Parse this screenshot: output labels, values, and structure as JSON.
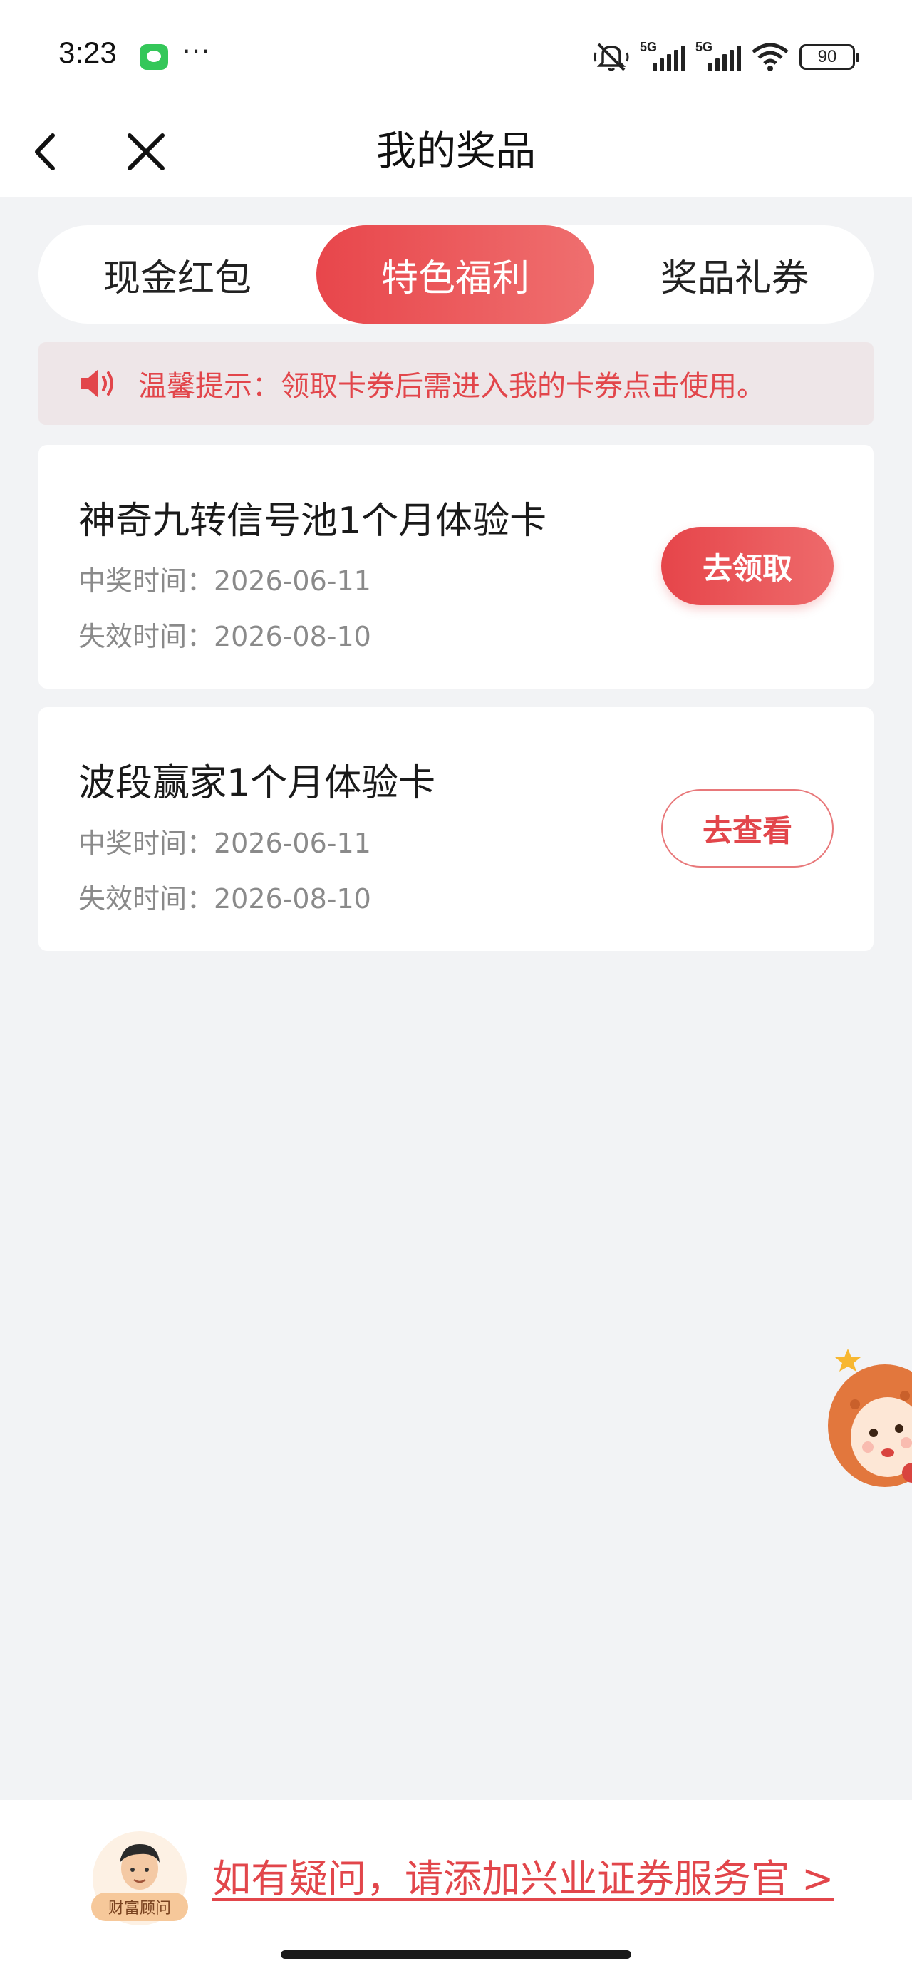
{
  "status_bar": {
    "time": "3:23",
    "network_1": "5G",
    "network_2": "5G",
    "battery": "90",
    "more": "···"
  },
  "nav": {
    "title": "我的奖品",
    "back_icon": "chevron-left-icon",
    "close_icon": "close-icon"
  },
  "tabs": [
    {
      "label": "现金红包",
      "active": false
    },
    {
      "label": "特色福利",
      "active": true
    },
    {
      "label": "奖品礼券",
      "active": false
    }
  ],
  "notice": {
    "icon": "speaker-icon",
    "text": "温馨提示：领取卡券后需进入我的卡券点击使用。"
  },
  "prizes": [
    {
      "title": "神奇九转信号池1个月体验卡",
      "win_time": "中奖时间：2026-06-11",
      "expire_time": "失效时间：2026-08-10",
      "action": "去领取"
    },
    {
      "title": "波段赢家1个月体验卡",
      "win_time": "中奖时间：2026-06-11",
      "expire_time": "失效时间：2026-08-10",
      "action": "去查看"
    }
  ],
  "footer": {
    "advisor_label": "财富顾问",
    "link": "如有疑问，请添加兴业证券服务官 >"
  },
  "colors": {
    "accent": "#e2464b",
    "background": "#f2f3f5"
  }
}
